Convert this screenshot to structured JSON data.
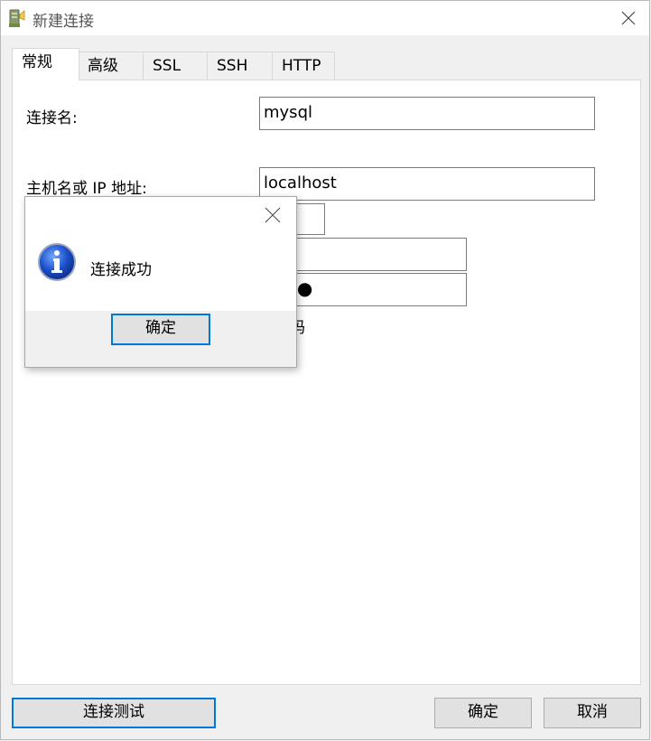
{
  "window": {
    "title": "新建连接"
  },
  "tabs": [
    "常规",
    "高级",
    "SSL",
    "SSH",
    "HTTP"
  ],
  "form": {
    "connection_name_label": "连接名:",
    "connection_name_value": "mysql",
    "host_label": "主机名或 IP 地址:",
    "host_value": "localhost",
    "port_visible": "6",
    "username_visible": ":",
    "password_mask": "●●●",
    "save_password_visible": "存密码"
  },
  "dialog": {
    "message": "连接成功",
    "ok_label": "确定"
  },
  "footer": {
    "test_label": "连接测试",
    "ok_label": "确定",
    "cancel_label": "取消"
  }
}
